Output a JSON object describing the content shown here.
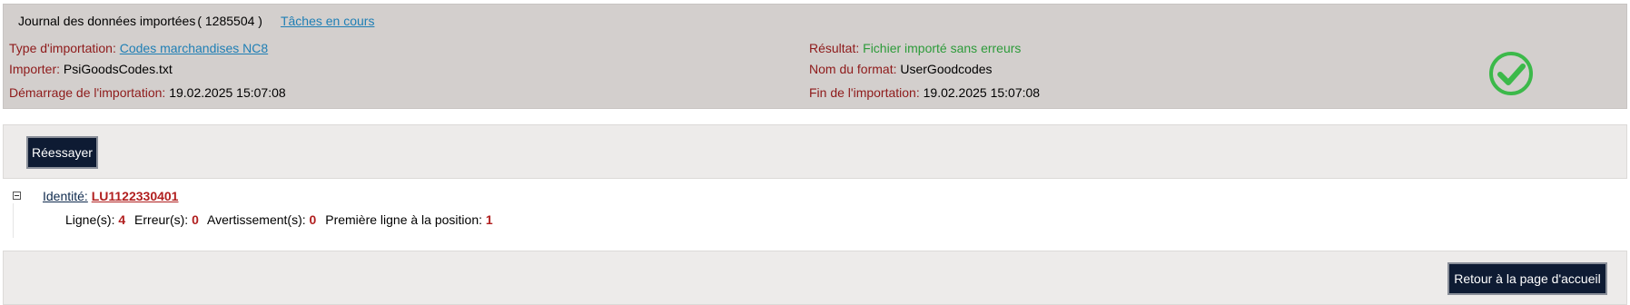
{
  "header": {
    "journal_title": "Journal des données importées",
    "journal_id": "( 1285504 )",
    "tasks_link": "Tâches en cours"
  },
  "info": {
    "import_type_label": "Type d'importation:",
    "import_type_value": "Codes marchandises NC8",
    "importer_label": "Importer:",
    "importer_value": "PsiGoodsCodes.txt",
    "start_label": "Démarrage de l'importation:",
    "start_value": "19.02.2025 15:07:08",
    "result_label": "Résultat:",
    "result_value": "Fichier importé sans erreurs",
    "format_label": "Nom du format:",
    "format_value": "UserGoodcodes",
    "end_label": "Fin de l'importation:",
    "end_value": "19.02.2025 15:07:08",
    "status_icon": "check-circle-icon",
    "status_color": "#3cb94a"
  },
  "actions": {
    "retry_label": "Réessayer"
  },
  "identity": {
    "label": "Identité:",
    "value": "LU1122330401",
    "lines_label": "Ligne(s):",
    "lines_value": "4",
    "errors_label": "Erreur(s):",
    "errors_value": "0",
    "warnings_label": "Avertissement(s):",
    "warnings_value": "0",
    "first_line_label": "Première ligne à la position:",
    "first_line_value": "1"
  },
  "footer": {
    "home_label": "Retour à la page d'accueil"
  }
}
